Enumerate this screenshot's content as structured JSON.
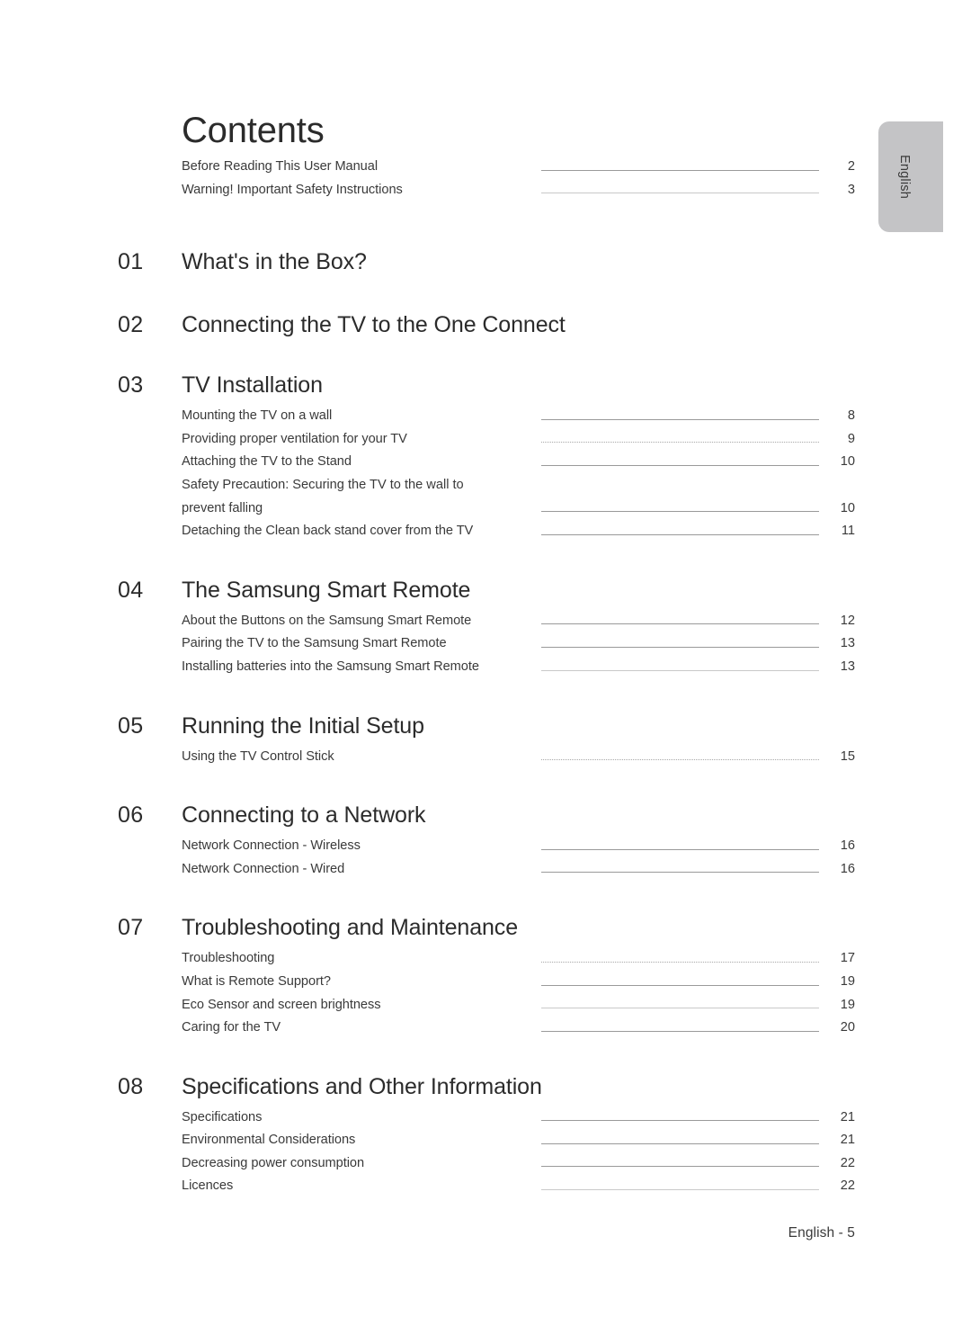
{
  "document": {
    "title": "Contents",
    "language_tab": "English",
    "footer": "English - 5"
  },
  "front_matter": [
    {
      "label": "Before Reading This User Manual",
      "page": "2",
      "leader": "solid"
    },
    {
      "label": "Warning! Important Safety Instructions",
      "page": "3",
      "leader": "faint"
    }
  ],
  "sections": [
    {
      "number": "01",
      "heading": "What's in the Box?",
      "items": []
    },
    {
      "number": "02",
      "heading": "Connecting the TV to the One Connect",
      "items": []
    },
    {
      "number": "03",
      "heading": "TV Installation",
      "items": [
        {
          "label": "Mounting the TV on a wall",
          "page": "8",
          "leader": "solid"
        },
        {
          "label": "Providing proper ventilation for your TV",
          "page": "9",
          "leader": "dotted"
        },
        {
          "label": "Attaching the TV to the Stand",
          "page": "10",
          "leader": "solid"
        },
        {
          "label": "Safety Precaution: Securing the TV to the wall to",
          "label2": "prevent falling",
          "page": "10",
          "leader": "solid",
          "wrapped": true
        },
        {
          "label": "Detaching the Clean back stand cover from the TV",
          "page": "11",
          "leader": "solid"
        }
      ]
    },
    {
      "number": "04",
      "heading": "The Samsung Smart Remote",
      "items": [
        {
          "label": "About the Buttons on the Samsung Smart Remote",
          "page": "12",
          "leader": "solid"
        },
        {
          "label": "Pairing the TV to the Samsung Smart Remote",
          "page": "13",
          "leader": "solid"
        },
        {
          "label": "Installing batteries into the Samsung Smart Remote",
          "page": "13",
          "leader": "faint"
        }
      ]
    },
    {
      "number": "05",
      "heading": "Running the Initial Setup",
      "items": [
        {
          "label": "Using the TV Control Stick",
          "page": "15",
          "leader": "dotted"
        }
      ]
    },
    {
      "number": "06",
      "heading": "Connecting to a Network",
      "items": [
        {
          "label": "Network Connection - Wireless",
          "page": "16",
          "leader": "solid"
        },
        {
          "label": "Network Connection - Wired",
          "page": "16",
          "leader": "solid"
        }
      ]
    },
    {
      "number": "07",
      "heading": "Troubleshooting and Maintenance",
      "items": [
        {
          "label": "Troubleshooting",
          "page": "17",
          "leader": "dotted"
        },
        {
          "label": "What is Remote Support?",
          "page": "19",
          "leader": "solid"
        },
        {
          "label": "Eco Sensor and screen brightness",
          "page": "19",
          "leader": "faint"
        },
        {
          "label": "Caring for the TV",
          "page": "20",
          "leader": "solid"
        }
      ]
    },
    {
      "number": "08",
      "heading": "Specifications and Other Information",
      "items": [
        {
          "label": "Specifications",
          "page": "21",
          "leader": "solid"
        },
        {
          "label": "Environmental Considerations",
          "page": "21",
          "leader": "solid"
        },
        {
          "label": "Decreasing power consumption",
          "page": "22",
          "leader": "solid"
        },
        {
          "label": "Licences",
          "page": "22",
          "leader": "faint"
        }
      ]
    }
  ],
  "colors": {
    "page_background": "#ffffff",
    "heading_text": "#2b2b2b",
    "body_text": "#3a3a3a",
    "leader_line": "#9a9a9a",
    "tab_background": "#c4c4c6"
  }
}
